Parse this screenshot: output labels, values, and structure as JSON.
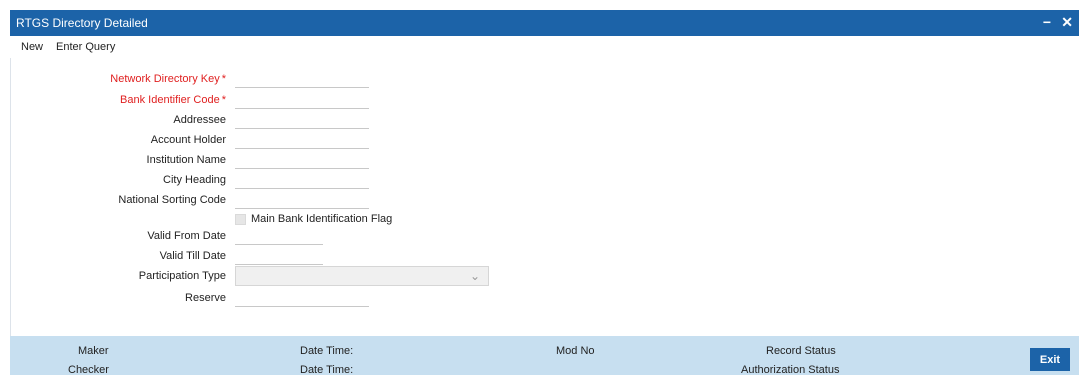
{
  "window": {
    "title": "RTGS Directory Detailed",
    "minimize_symbol": "−",
    "close_symbol": "✕"
  },
  "toolbar": {
    "new_label": "New",
    "enter_query_label": "Enter Query"
  },
  "form": {
    "network_directory_key": {
      "label": "Network Directory Key",
      "required": "*",
      "value": ""
    },
    "bank_identifier_code": {
      "label": "Bank Identifier Code",
      "required": "*",
      "value": ""
    },
    "addressee": {
      "label": "Addressee",
      "value": ""
    },
    "account_holder": {
      "label": "Account Holder",
      "value": ""
    },
    "institution_name": {
      "label": "Institution Name",
      "value": ""
    },
    "city_heading": {
      "label": "City Heading",
      "value": ""
    },
    "national_sorting_code": {
      "label": "National Sorting Code",
      "value": ""
    },
    "main_bank_flag": {
      "label": "Main Bank Identification Flag",
      "checked": false
    },
    "valid_from_date": {
      "label": "Valid From Date",
      "value": ""
    },
    "valid_till_date": {
      "label": "Valid Till Date",
      "value": ""
    },
    "participation_type": {
      "label": "Participation Type",
      "value": ""
    },
    "reserve": {
      "label": "Reserve",
      "value": ""
    }
  },
  "footer": {
    "maker": "Maker",
    "checker": "Checker",
    "date_time_1": "Date Time:",
    "date_time_2": "Date Time:",
    "mod_no": "Mod No",
    "record_status": "Record Status",
    "authorization_status": "Authorization Status",
    "exit_label": "Exit"
  },
  "colors": {
    "titlebar": "#1c63a8",
    "footer": "#c7dff0",
    "required_label": "#e02020"
  }
}
